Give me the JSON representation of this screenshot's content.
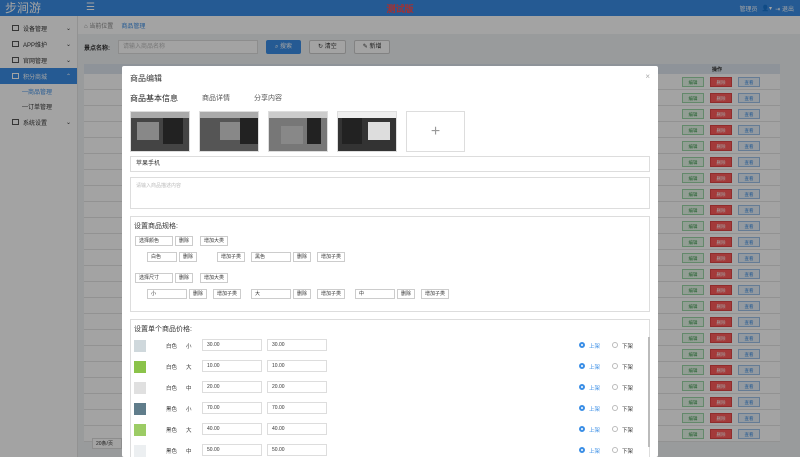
{
  "app": {
    "logo": "步涧游",
    "menu_icon": "hamburger-icon",
    "test_title": "测试版",
    "user_name": "管理员",
    "logout": "退出"
  },
  "sidebar": {
    "items": [
      {
        "label": "设备管理",
        "icon": "device-icon"
      },
      {
        "label": "APP维护",
        "icon": "app-icon"
      },
      {
        "label": "官网管理",
        "icon": "web-icon"
      },
      {
        "label": "积分商城",
        "icon": "mall-icon",
        "active": true
      },
      {
        "label": "系统设置",
        "icon": "settings-icon"
      }
    ],
    "subitems": [
      {
        "label": "商品管理",
        "active": true
      },
      {
        "label": "订单管理"
      }
    ]
  },
  "breadcrumb": {
    "prefix": "当前位置",
    "current": "商品管理"
  },
  "search": {
    "label": "景点名称:",
    "placeholder": "请输入商品名称",
    "search_btn": "搜索",
    "clear_btn": "清空",
    "add_btn": "新增"
  },
  "table": {
    "header_ops": "操作",
    "row_actions": [
      "编辑",
      "删除",
      "查看"
    ],
    "row_count": 23
  },
  "pager": {
    "page_size": "20条/页"
  },
  "modal": {
    "title": "商品编辑",
    "close": "×",
    "tabs": [
      "商品基本信息",
      "商品详情",
      "分享内容"
    ],
    "product_name": "苹果手机",
    "desc_placeholder": "请输入商品描述内容",
    "spec": {
      "title": "设置商品规格:",
      "delete": "删除",
      "add_major": "增加大类",
      "add_sub": "增加子类",
      "group1": {
        "name": "选择颜色",
        "values": [
          "白色",
          "黑色"
        ]
      },
      "group2": {
        "name": "选择尺寸",
        "values": [
          "小",
          "大",
          "中"
        ]
      }
    },
    "price": {
      "title": "设置单个商品价格:",
      "on_label": "上架",
      "off_label": "下架",
      "rows": [
        {
          "color": "白色",
          "size": "小",
          "p1": "30.00",
          "p2": "30.00"
        },
        {
          "color": "白色",
          "size": "大",
          "p1": "10.00",
          "p2": "10.00"
        },
        {
          "color": "白色",
          "size": "中",
          "p1": "20.00",
          "p2": "20.00"
        },
        {
          "color": "黑色",
          "size": "小",
          "p1": "70.00",
          "p2": "70.00"
        },
        {
          "color": "黑色",
          "size": "大",
          "p1": "40.00",
          "p2": "40.00"
        },
        {
          "color": "黑色",
          "size": "中",
          "p1": "50.00",
          "p2": "50.00"
        }
      ]
    }
  }
}
